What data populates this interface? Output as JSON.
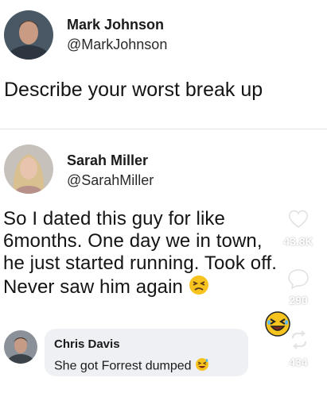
{
  "post": {
    "author_name": "Mark Johnson",
    "author_handle": "@MarkJohnson",
    "text": "Describe your worst break up"
  },
  "reply": {
    "author_name": "Sarah Miller",
    "author_handle": "@SarahMiller",
    "lines": [
      "So I dated this guy for like",
      "6months. One day we in town,",
      "he just started running. Took off.",
      "Never saw him again"
    ]
  },
  "comment": {
    "author_name": "Chris Davis",
    "text": "She got Forrest dumped"
  },
  "overlay": {
    "likes": "43.8K",
    "comments": "290",
    "shares": "434"
  },
  "icons": {
    "angry": "persevering-face-emoji",
    "laugh": "squinting-laughing-emoji",
    "sweat": "grinning-sweat-emoji",
    "heart": "heart-icon",
    "comment": "comment-icon",
    "share": "share-icon"
  },
  "colors": {
    "bubble": "#eef0f3",
    "emoji": "#f7c31f"
  }
}
